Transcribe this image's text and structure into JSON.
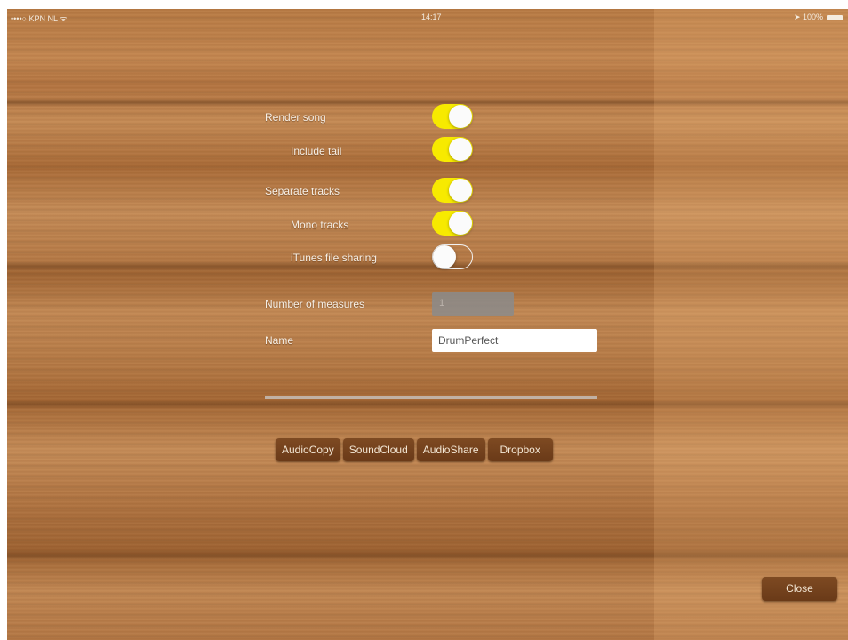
{
  "status_bar": {
    "carrier": "••••○ KPN NL ᯤ",
    "time": "14:17",
    "battery": "➤ 100%"
  },
  "settings": {
    "render_song": {
      "label": "Render song",
      "on": true
    },
    "include_tail": {
      "label": "Include tail",
      "on": true
    },
    "separate_tracks": {
      "label": "Separate tracks",
      "on": true
    },
    "mono_tracks": {
      "label": "Mono tracks",
      "on": true
    },
    "itunes_file_sharing": {
      "label": "iTunes file sharing",
      "on": false
    },
    "number_of_measures": {
      "label": "Number of measures",
      "value": "1"
    },
    "name": {
      "label": "Name",
      "value": "DrumPerfect"
    }
  },
  "share_buttons": [
    "AudioCopy",
    "SoundCloud",
    "AudioShare",
    "Dropbox"
  ],
  "close_label": "Close",
  "colors": {
    "toggle_on": "#f7ea00",
    "button_bg": "#7a4520"
  }
}
